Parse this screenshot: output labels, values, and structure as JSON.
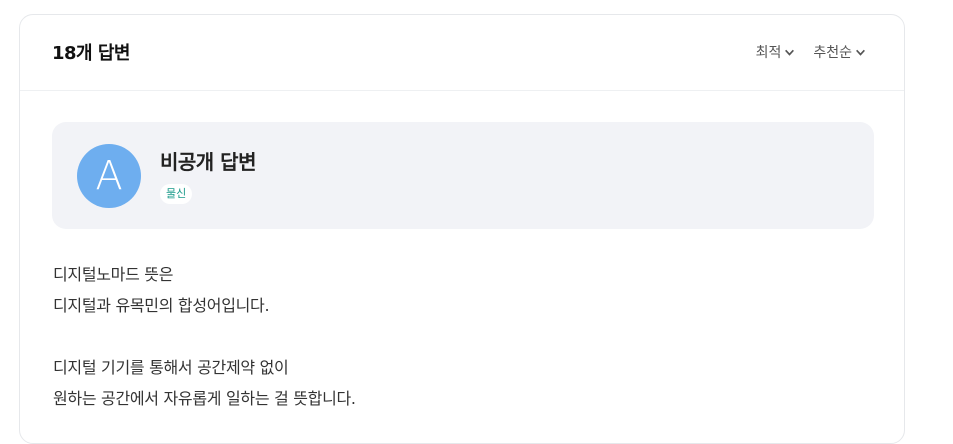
{
  "header": {
    "answer_count": "18개 답변",
    "sort_options": [
      "최적",
      "추천순"
    ]
  },
  "author": {
    "avatar_letter": "A",
    "name": "비공개 답변",
    "tag": "물신"
  },
  "answer": {
    "lines": [
      "디지털노마드 뜻은",
      "디지털과 유목민의 합성어입니다.",
      "",
      "디지털 기기를 통해서 공간제약 없이",
      "원하는 공간에서 자유롭게 일하는 걸 뜻합니다."
    ]
  },
  "colors": {
    "avatar_bg": "#6eaeef",
    "tag_text": "#1a9a8a",
    "profile_bg": "#f2f3f7"
  }
}
